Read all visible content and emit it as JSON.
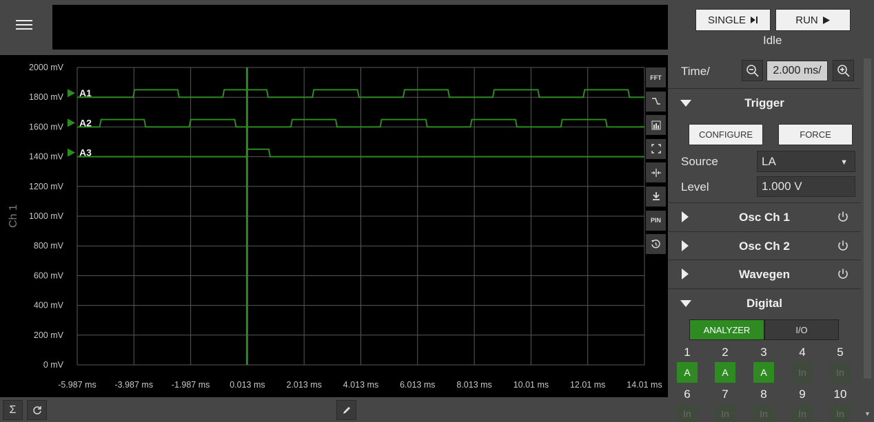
{
  "toolbar": {
    "single_label": "SINGLE",
    "run_label": "RUN",
    "status": "Idle"
  },
  "time": {
    "label": "Time/",
    "value": "2.000 ms/"
  },
  "trigger": {
    "title": "Trigger",
    "configure_label": "CONFIGURE",
    "force_label": "FORCE",
    "source_label": "Source",
    "source_value": "LA",
    "level_label": "Level",
    "level_value": "1.000 V"
  },
  "sections": {
    "osc1": "Osc Ch 1",
    "osc2": "Osc Ch 2",
    "wavegen": "Wavegen"
  },
  "digital": {
    "title": "Digital",
    "tab_analyzer": "ANALYZER",
    "tab_io": "I/O",
    "pins_row1": [
      {
        "num": "1",
        "state": "A"
      },
      {
        "num": "2",
        "state": "A"
      },
      {
        "num": "3",
        "state": "A"
      },
      {
        "num": "4",
        "state": "In"
      },
      {
        "num": "5",
        "state": "In"
      }
    ],
    "pins_row2": [
      {
        "num": "6",
        "state": "In"
      },
      {
        "num": "7",
        "state": "In"
      },
      {
        "num": "8",
        "state": "In"
      },
      {
        "num": "9",
        "state": "In"
      },
      {
        "num": "10",
        "state": "In"
      }
    ]
  },
  "tools": [
    "FFT",
    "PIN"
  ],
  "colors": {
    "trace": "#2e8b22",
    "grid": "#5a5a5a",
    "active_pin": "#2e8b22"
  },
  "chart_data": {
    "type": "line",
    "ylabel": "Ch 1",
    "y_ticks": [
      "2000 mV",
      "1800 mV",
      "1600 mV",
      "1400 mV",
      "1200 mV",
      "1000 mV",
      "800 mV",
      "600 mV",
      "400 mV",
      "200 mV",
      "0 mV"
    ],
    "x_ticks": [
      "-5.987 ms",
      "-3.987 ms",
      "-1.987 ms",
      "0.013 ms",
      "2.013 ms",
      "4.013 ms",
      "6.013 ms",
      "8.013 ms",
      "10.01 ms",
      "12.01 ms",
      "14.01 ms"
    ],
    "ylim": [
      0,
      2000
    ],
    "xlim": [
      -5.987,
      14.013
    ],
    "trigger_time_ms": 0.0,
    "pulse_amplitude_mv": 50,
    "series": [
      {
        "name": "A1",
        "baseline_mv": 1800,
        "high_intervals_ms": [
          [
            -3.99,
            -2.42
          ],
          [
            -0.83,
            0.72
          ],
          [
            2.33,
            3.92
          ],
          [
            5.53,
            7.11
          ],
          [
            8.69,
            10.28
          ],
          [
            11.88,
            13.46
          ]
        ]
      },
      {
        "name": "A2",
        "baseline_mv": 1600,
        "high_intervals_ms": [
          [
            -5.17,
            -3.6
          ],
          [
            -2.01,
            -0.41
          ],
          [
            1.57,
            3.15
          ],
          [
            4.72,
            6.33
          ],
          [
            7.9,
            9.49
          ],
          [
            11.09,
            12.67
          ]
        ]
      },
      {
        "name": "A3",
        "baseline_mv": 1400,
        "high_intervals_ms": [
          [
            0.0,
            0.79
          ]
        ]
      }
    ]
  }
}
